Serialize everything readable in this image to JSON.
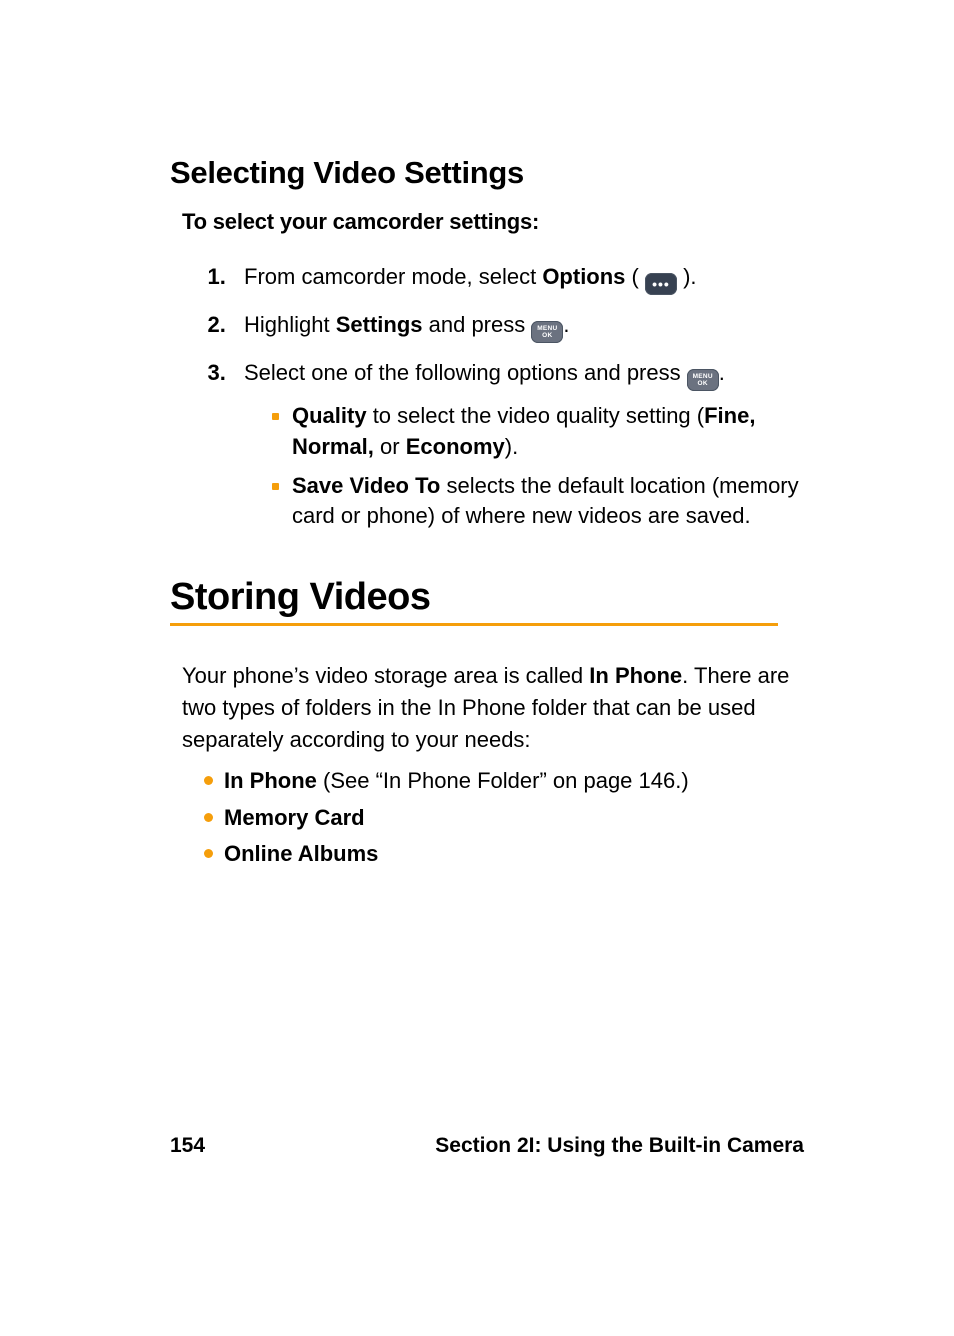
{
  "section_heading": "Selecting Video Settings",
  "lead": "To select your camcorder settings:",
  "steps": {
    "s1": {
      "pre": "From camcorder mode, select ",
      "bold": "Options",
      "post_open": " ( ",
      "post_close": " )."
    },
    "s2": {
      "pre": "Highlight ",
      "bold": "Settings",
      "post": " and press ",
      "tail": "."
    },
    "s3": {
      "pre": "Select one of the following options and press ",
      "tail": ".",
      "sub": {
        "a": {
          "bold": "Quality",
          "mid": " to select the video quality setting (",
          "b1": "Fine, Normal,",
          "mid2": " or ",
          "b2": "Economy",
          "end": ")."
        },
        "b": {
          "bold": "Save Video To",
          "rest": " selects the default location (memory card or phone) of where new videos are saved."
        }
      }
    }
  },
  "main_heading": "Storing Videos",
  "para": {
    "p1a": "Your phone’s video storage area is called ",
    "p1b": "In Phone",
    "p1c": ". There are two types of folders in the In Phone folder that can be used separately according to your needs:"
  },
  "bullets": {
    "b1": {
      "bold": "In Phone",
      "rest": " (See “In Phone Folder” on page 146.)"
    },
    "b2": {
      "bold": "Memory Card"
    },
    "b3": {
      "bold": "Online Albums"
    }
  },
  "footer": {
    "page": "154",
    "section": "Section 2I: Using the Built-in Camera"
  },
  "icons": {
    "options_glyph": "•••",
    "menuok_line1": "MENU",
    "menuok_line2": "OK"
  }
}
